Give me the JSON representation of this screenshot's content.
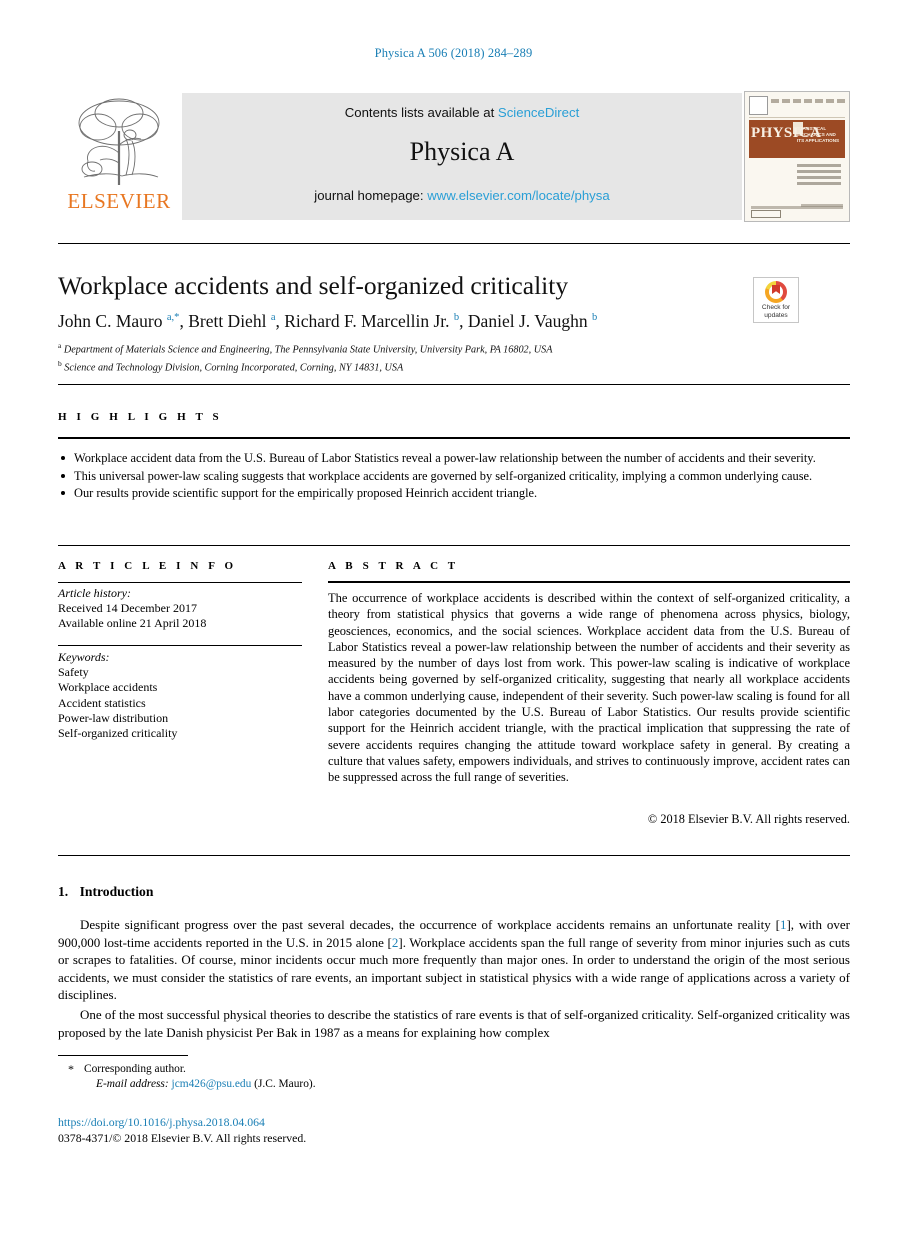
{
  "running_head": "Physica A 506 (2018) 284–289",
  "masthead": {
    "publisher": "ELSEVIER",
    "contents_prefix": "Contents lists available at ",
    "contents_link": "ScienceDirect",
    "journal_title": "Physica A",
    "homepage_prefix": "journal homepage: ",
    "homepage_link": "www.elsevier.com/locate/physa",
    "cover": {
      "brand": "PHYSICA",
      "subtitle": "STATISTICAL MECHANICS AND ITS APPLICATIONS"
    }
  },
  "article": {
    "title": "Workplace accidents and self-organized criticality",
    "authors_html": "John C. Mauro <sup>a,*</sup>, Brett Diehl <sup>a</sup>, Richard F. Marcellin Jr. <sup>b</sup>, Daniel J. Vaughn <sup>b</sup>",
    "affiliations": [
      {
        "marker": "a",
        "text": "Department of Materials Science and Engineering, The Pennsylvania State University, University Park, PA 16802, USA"
      },
      {
        "marker": "b",
        "text": "Science and Technology Division, Corning Incorporated, Corning, NY 14831, USA"
      }
    ],
    "crossmark": {
      "line1": "Check for",
      "line2": "updates"
    }
  },
  "highlights": {
    "heading": "H I G H L I G H T S",
    "items": [
      "Workplace accident data from the U.S. Bureau of Labor Statistics reveal a power-law relationship between the number of accidents and their severity.",
      "This universal power-law scaling suggests that workplace accidents are governed by self-organized criticality, implying a common underlying cause.",
      "Our results provide scientific support for the empirically proposed Heinrich accident triangle."
    ]
  },
  "article_info": {
    "heading": "A R T I C L E    I N F O",
    "history_label": "Article history:",
    "received": "Received 14 December 2017",
    "available": "Available online 21 April 2018",
    "keywords_label": "Keywords:",
    "keywords": [
      "Safety",
      "Workplace accidents",
      "Accident statistics",
      "Power-law distribution",
      "Self-organized criticality"
    ]
  },
  "abstract": {
    "heading": "A B S T R A C T",
    "text": "The occurrence of workplace accidents is described within the context of self-organized criticality, a theory from statistical physics that governs a wide range of phenomena across physics, biology, geosciences, economics, and the social sciences. Workplace accident data from the U.S. Bureau of Labor Statistics reveal a power-law relationship between the number of accidents and their severity as measured by the number of days lost from work. This power-law scaling is indicative of workplace accidents being governed by self-organized criticality, suggesting that nearly all workplace accidents have a common underlying cause, independent of their severity. Such power-law scaling is found for all labor categories documented by the U.S. Bureau of Labor Statistics. Our results provide scientific support for the Heinrich accident triangle, with the practical implication that suppressing the rate of severe accidents requires changing the attitude toward workplace safety in general. By creating a culture that values safety, empowers individuals, and strives to continuously improve, accident rates can be suppressed across the full range of severities.",
    "copyright": "© 2018 Elsevier B.V. All rights reserved."
  },
  "body": {
    "section_number": "1.",
    "section_title": "Introduction",
    "paragraph1_a": "Despite significant progress over the past several decades, the occurrence of workplace accidents remains an unfortunate reality [",
    "paragraph1_ref1": "1",
    "paragraph1_b": "], with over 900,000 lost-time accidents reported in the U.S. in 2015 alone [",
    "paragraph1_ref2": "2",
    "paragraph1_c": "]. Workplace accidents span the full range of severity from minor injuries such as cuts or scrapes to fatalities. Of course, minor incidents occur much more frequently than major ones. In order to understand the origin of the most serious accidents, we must consider the statistics of rare events, an important subject in statistical physics with a wide range of applications across a variety of disciplines.",
    "paragraph2": "One of the most successful physical theories to describe the statistics of rare events is that of self-organized criticality. Self-organized criticality was proposed by the late Danish physicist Per Bak in 1987 as a means for explaining how complex"
  },
  "footnotes": {
    "corresponding": "Corresponding author.",
    "email_label": "E-mail address:",
    "email": "jcm426@psu.edu",
    "email_suffix": "(J.C. Mauro).",
    "doi": "https://doi.org/10.1016/j.physa.2018.04.064",
    "issn_line": "0378-4371/© 2018 Elsevier B.V. All rights reserved."
  }
}
